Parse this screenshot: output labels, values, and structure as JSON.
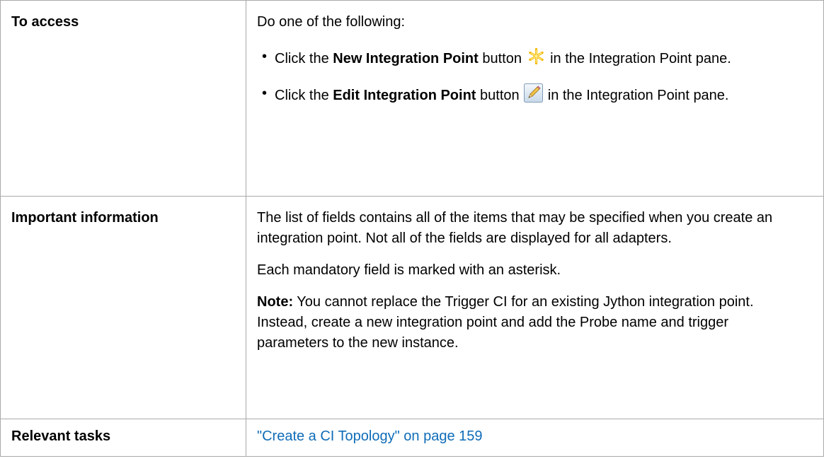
{
  "rows": {
    "access": {
      "label": "To access",
      "intro": "Do one of the following:",
      "items": [
        {
          "prefix": "Click the ",
          "bold": "New Integration Point",
          "middle": " button ",
          "icon": "new-star-icon",
          "suffix": " in the Integration Point pane."
        },
        {
          "prefix": "Click the ",
          "bold": "Edit Integration Point",
          "middle": " button ",
          "icon": "edit-pencil-icon",
          "suffix": " in the Integration Point pane."
        }
      ]
    },
    "important": {
      "label": "Important information",
      "para1": "The list of fields contains all of the items that may be specified when you create an integration point. Not all of the fields are displayed for all adapters.",
      "para2": "Each mandatory field is marked with an asterisk.",
      "note_label": "Note:",
      "note_text": " You cannot replace the Trigger CI for an existing Jython integration point. Instead, create a new integration point and add the Probe name and trigger parameters to the new instance."
    },
    "tasks": {
      "label": "Relevant tasks",
      "link": "\"Create a CI Topology\" on page 159"
    }
  },
  "colors": {
    "border": "#a9a9a9",
    "link": "#0f6cb8",
    "star": "#f5b800"
  }
}
